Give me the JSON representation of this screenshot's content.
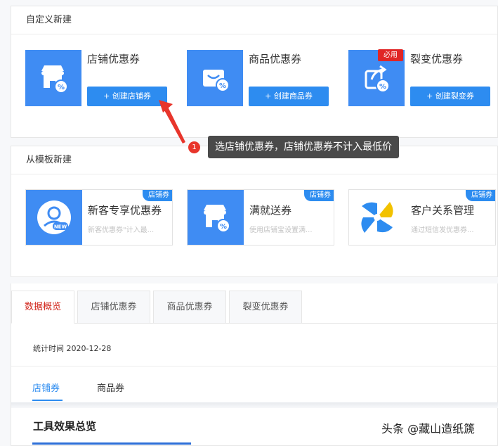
{
  "custom_section": {
    "title": "自定义新建",
    "cards": [
      {
        "title": "店铺优惠券",
        "button": "+ 创建店铺券",
        "icon": "shop-coupon-icon"
      },
      {
        "title": "商品优惠券",
        "button": "+ 创建商品券",
        "icon": "bag-coupon-icon"
      },
      {
        "title": "裂变优惠券",
        "button": "+ 创建裂变券",
        "icon": "share-coupon-icon",
        "badge": "必用"
      }
    ]
  },
  "template_section": {
    "title": "从模板新建",
    "cards": [
      {
        "title": "新客专享优惠券",
        "desc": "新客优惠券\"计入最...",
        "corner": "店铺券",
        "icon": "new-user-icon"
      },
      {
        "title": "满就送券",
        "desc": "使用店铺宝设置满...",
        "corner": "店铺券",
        "icon": "shop-coupon-icon"
      },
      {
        "title": "客户关系管理",
        "desc": "通过短信发优惠券...",
        "corner": "店铺券",
        "icon": "crm-logo-icon"
      }
    ]
  },
  "tooltip": {
    "number": "1",
    "text": "选店铺优惠券，店铺优惠券不计入最低价"
  },
  "data_section": {
    "tabs": [
      "数据概览",
      "店铺优惠券",
      "商品优惠券",
      "裂变优惠券"
    ],
    "stat_time": "统计时间 2020-12-28",
    "subtabs": [
      "店铺券",
      "商品券"
    ],
    "effect_title": "工具效果总览"
  },
  "watermark": "头条 @藏山造纸篪",
  "colors": {
    "accent": "#2d8cf0",
    "thumb": "#3f8cf3",
    "active_tab": "#d2281e",
    "badge": "#e02525"
  }
}
